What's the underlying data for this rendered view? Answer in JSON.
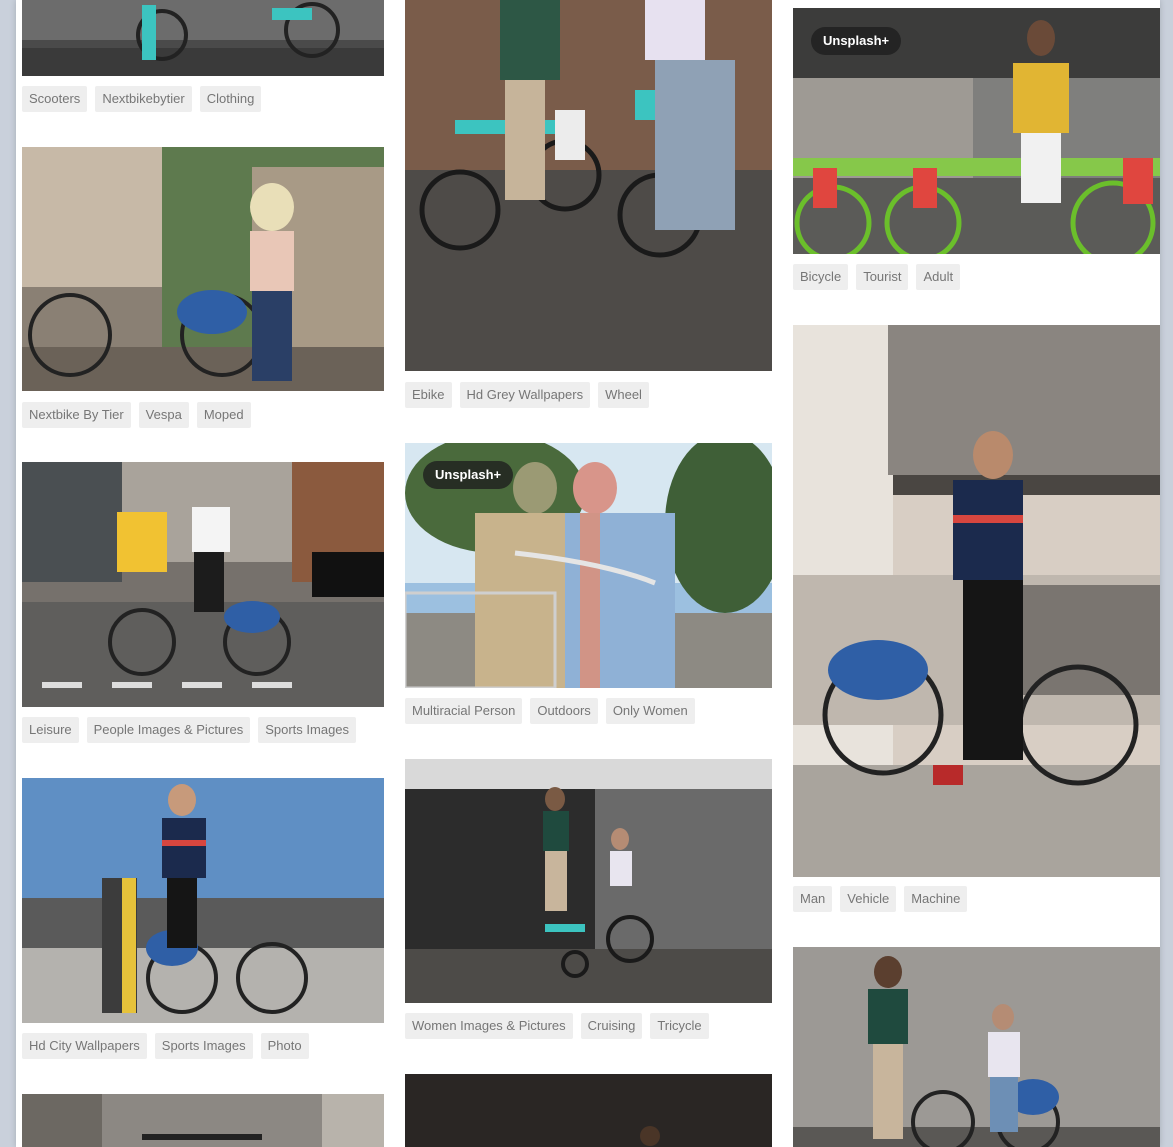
{
  "badges": {
    "premium_label": "Unsplash+"
  },
  "columns": [
    {
      "items": [
        {
          "kind": "photo",
          "alt": "",
          "tags": [
            "Scooters",
            "Nextbikebytier",
            "Clothing"
          ]
        },
        {
          "kind": "photo",
          "alt": "",
          "tags": [
            "Nextbike By Tier",
            "Vespa",
            "Moped"
          ]
        },
        {
          "kind": "photo",
          "alt": "",
          "tags": [
            "Leisure",
            "People Images & Pictures",
            "Sports Images"
          ]
        },
        {
          "kind": "photo",
          "alt": "",
          "tags": [
            "Hd City Wallpapers",
            "Sports Images",
            "Photo"
          ]
        }
      ]
    },
    {
      "items": [
        {
          "kind": "photo",
          "tags": [
            "Ebike",
            "Hd Grey Wallpapers",
            "Wheel"
          ]
        },
        {
          "kind": "photo",
          "premium": true,
          "tags": [
            "Multiracial Person",
            "Outdoors",
            "Only Women"
          ]
        },
        {
          "kind": "photo",
          "tags": [
            "Women Images & Pictures",
            "Cruising",
            "Tricycle"
          ]
        }
      ]
    },
    {
      "items": [
        {
          "kind": "photo",
          "premium": true,
          "tags": [
            "Bicycle",
            "Tourist",
            "Adult"
          ]
        },
        {
          "kind": "photo",
          "tags": [
            "Man",
            "Vehicle",
            "Machine"
          ]
        }
      ]
    }
  ]
}
